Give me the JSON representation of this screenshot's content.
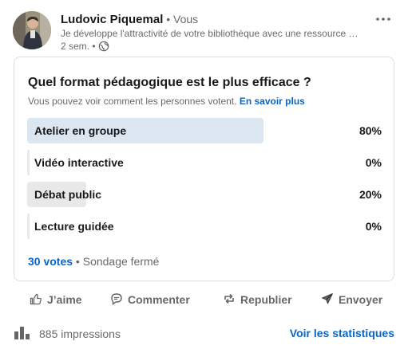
{
  "post": {
    "author_name": "Ludovic Piquemal",
    "author_separator": " • ",
    "author_relation": "Vous",
    "headline": "Je développe l'attractivité de votre bibliothèque avec une ressource …",
    "time": "2 sem. •",
    "visibility_icon": "globe-icon",
    "more_icon": "more-horizontal-icon"
  },
  "poll": {
    "question": "Quel format pédagogique est le plus efficace ?",
    "subtitle": "Vous pouvez voir comment les personnes votent.",
    "learn_more": "En savoir plus",
    "options": [
      {
        "label": "Atelier en groupe",
        "percent_text": "80%",
        "percent": 80
      },
      {
        "label": "Vidéo interactive",
        "percent_text": "0%",
        "percent": 0
      },
      {
        "label": "Débat public",
        "percent_text": "20%",
        "percent": 20
      },
      {
        "label": "Lecture guidée",
        "percent_text": "0%",
        "percent": 0
      }
    ],
    "votes": "30 votes",
    "status": " • Sondage fermé"
  },
  "actions": {
    "like": "J’aime",
    "comment": "Commenter",
    "repost": "Republier",
    "send": "Envoyer"
  },
  "stats": {
    "impressions": "885 impressions",
    "view_stats": "Voir les statistiques"
  },
  "colors": {
    "accent": "#0a66c2",
    "winning_bar": "#dce6f1",
    "other_bar": "#e8e8e8"
  }
}
